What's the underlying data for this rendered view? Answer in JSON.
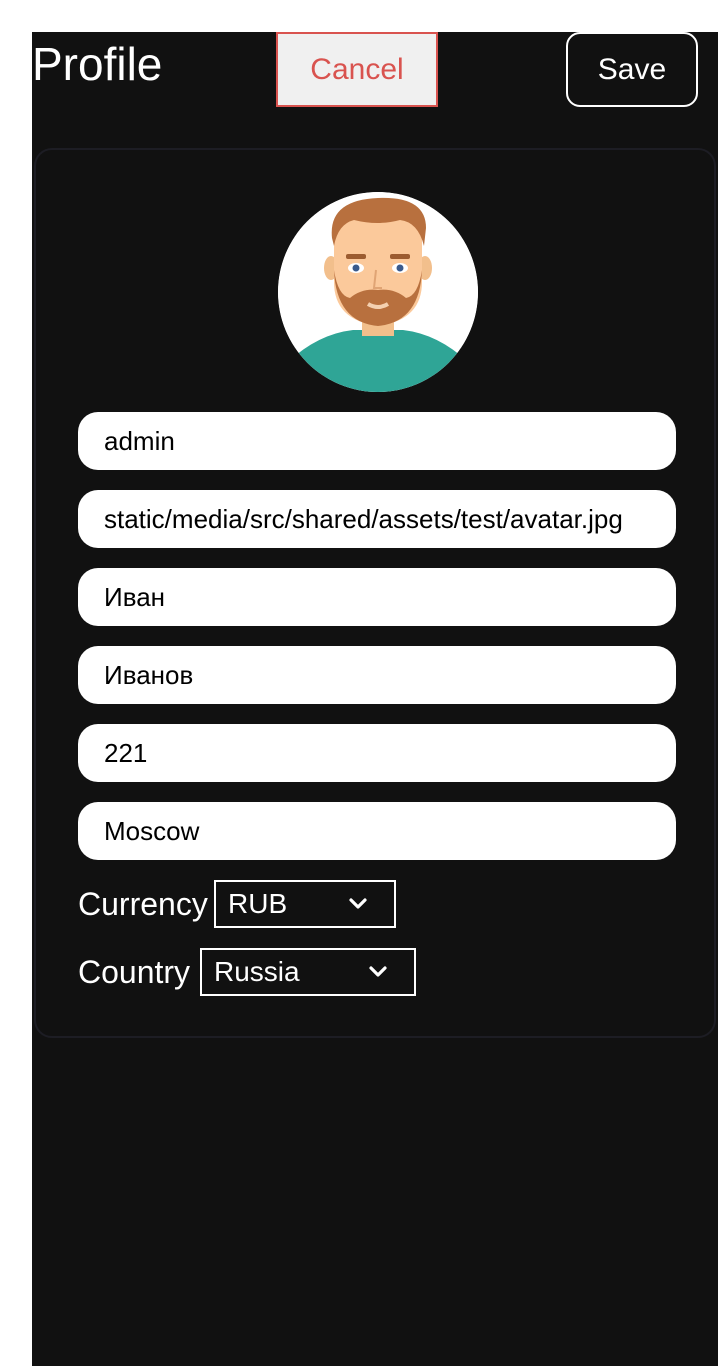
{
  "header": {
    "title": "Profile",
    "cancel_label": "Cancel",
    "save_label": "Save"
  },
  "profile": {
    "avatar_icon": "user-avatar-icon",
    "fields": {
      "username": "admin",
      "avatar_path": "static/media/src/shared/assets/test/avatar.jpg",
      "first_name": "Иван",
      "last_name": "Иванов",
      "age": "221",
      "city": "Moscow"
    },
    "currency": {
      "label": "Currency",
      "selected": "RUB"
    },
    "country": {
      "label": "Country",
      "selected": "Russia"
    }
  },
  "colors": {
    "background": "#111111",
    "cancel_accent": "#d9534f",
    "cancel_bg": "#f0f0f0",
    "avatar_shirt": "#2fa596"
  }
}
